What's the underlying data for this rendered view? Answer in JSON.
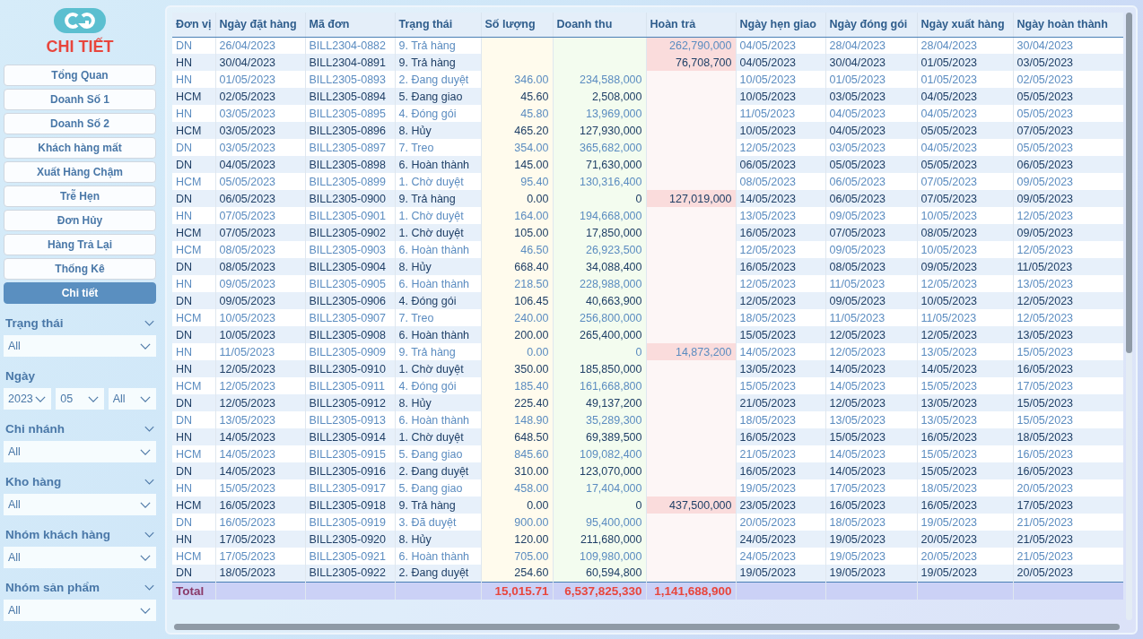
{
  "sidebar": {
    "title": "CHI TIẾT",
    "nav": [
      {
        "label": "Tổng Quan",
        "selected": false
      },
      {
        "label": "Doanh Số 1",
        "selected": false
      },
      {
        "label": "Doanh Số 2",
        "selected": false
      },
      {
        "label": "Khách hàng mất",
        "selected": false
      },
      {
        "label": "Xuất Hàng Chậm",
        "selected": false
      },
      {
        "label": "Trễ Hẹn",
        "selected": false
      },
      {
        "label": "Đơn Hủy",
        "selected": false
      },
      {
        "label": "Hàng Trả Lại",
        "selected": false
      },
      {
        "label": "Thống Kê",
        "selected": false
      },
      {
        "label": "Chi tiết",
        "selected": true
      }
    ],
    "filters": [
      {
        "kind": "slicer",
        "label": "Trạng thái",
        "dropdowns": [
          "All"
        ]
      },
      {
        "kind": "date",
        "label": "Ngày",
        "dropdowns": [
          "2023",
          "05",
          "All"
        ]
      },
      {
        "kind": "slicer",
        "label": "Chi nhánh",
        "dropdowns": [
          "All"
        ]
      },
      {
        "kind": "slicer",
        "label": "Kho hàng",
        "dropdowns": [
          "All"
        ]
      },
      {
        "kind": "slicer",
        "label": "Nhóm khách hàng",
        "dropdowns": [
          "All"
        ]
      },
      {
        "kind": "slicer",
        "label": "Nhóm sản phẩm",
        "dropdowns": [
          "All"
        ]
      }
    ]
  },
  "table": {
    "columns": [
      {
        "label": "Đơn vị",
        "kind": "text"
      },
      {
        "label": "Ngày đặt hàng",
        "kind": "text"
      },
      {
        "label": "Mã đơn",
        "kind": "text"
      },
      {
        "label": "Trạng thái",
        "kind": "text"
      },
      {
        "label": "Số lượng",
        "kind": "quantity"
      },
      {
        "label": "Doanh thu",
        "kind": "revenue"
      },
      {
        "label": "Hoàn trả",
        "kind": "refund"
      },
      {
        "label": "Ngày hẹn giao",
        "kind": "text"
      },
      {
        "label": "Ngày đóng gói",
        "kind": "text"
      },
      {
        "label": "Ngày xuất hàng",
        "kind": "text"
      },
      {
        "label": "Ngày hoàn thành",
        "kind": "text"
      }
    ],
    "rows": [
      {
        "unit": "DN",
        "ordered": "26/04/2023",
        "id": "BILL2304-0882",
        "status": "9. Trả hàng",
        "refund": "262,790,000",
        "due": "04/05/2023",
        "packed": "28/04/2023",
        "shipped": "28/04/2023",
        "completed": "30/04/2023"
      },
      {
        "unit": "HN",
        "ordered": "30/04/2023",
        "id": "BILL2304-0891",
        "status": "9. Trả hàng",
        "refund": "76,708,700",
        "due": "04/05/2023",
        "packed": "30/04/2023",
        "shipped": "01/05/2023",
        "completed": "03/05/2023"
      },
      {
        "unit": "HN",
        "ordered": "01/05/2023",
        "id": "BILL2305-0893",
        "status": "2. Đang duyệt",
        "qty": "346.00",
        "revenue": "234,588,000",
        "due": "10/05/2023",
        "packed": "01/05/2023",
        "shipped": "01/05/2023",
        "completed": "02/05/2023"
      },
      {
        "unit": "HCM",
        "ordered": "02/05/2023",
        "id": "BILL2305-0894",
        "status": "5. Đang giao",
        "qty": "45.60",
        "revenue": "2,508,000",
        "due": "10/05/2023",
        "packed": "03/05/2023",
        "shipped": "04/05/2023",
        "completed": "05/05/2023"
      },
      {
        "unit": "HN",
        "ordered": "03/05/2023",
        "id": "BILL2305-0895",
        "status": "4. Đóng gói",
        "qty": "45.80",
        "revenue": "13,969,000",
        "due": "11/05/2023",
        "packed": "04/05/2023",
        "shipped": "04/05/2023",
        "completed": "05/05/2023"
      },
      {
        "unit": "HCM",
        "ordered": "03/05/2023",
        "id": "BILL2305-0896",
        "status": "8. Hủy",
        "qty": "465.20",
        "revenue": "127,930,000",
        "due": "10/05/2023",
        "packed": "04/05/2023",
        "shipped": "05/05/2023",
        "completed": "07/05/2023"
      },
      {
        "unit": "DN",
        "ordered": "03/05/2023",
        "id": "BILL2305-0897",
        "status": "7. Treo",
        "qty": "354.00",
        "revenue": "365,682,000",
        "due": "12/05/2023",
        "packed": "03/05/2023",
        "shipped": "04/05/2023",
        "completed": "05/05/2023"
      },
      {
        "unit": "DN",
        "ordered": "04/05/2023",
        "id": "BILL2305-0898",
        "status": "6. Hoàn thành",
        "qty": "145.00",
        "revenue": "71,630,000",
        "due": "06/05/2023",
        "packed": "05/05/2023",
        "shipped": "05/05/2023",
        "completed": "06/05/2023"
      },
      {
        "unit": "HCM",
        "ordered": "05/05/2023",
        "id": "BILL2305-0899",
        "status": "1. Chờ duyệt",
        "qty": "95.40",
        "revenue": "130,316,400",
        "due": "08/05/2023",
        "packed": "06/05/2023",
        "shipped": "07/05/2023",
        "completed": "09/05/2023"
      },
      {
        "unit": "DN",
        "ordered": "06/05/2023",
        "id": "BILL2305-0900",
        "status": "9. Trả hàng",
        "qty": "0.00",
        "revenue": "0",
        "refund": "127,019,000",
        "due": "14/05/2023",
        "packed": "06/05/2023",
        "shipped": "07/05/2023",
        "completed": "09/05/2023"
      },
      {
        "unit": "HN",
        "ordered": "07/05/2023",
        "id": "BILL2305-0901",
        "status": "1. Chờ duyệt",
        "qty": "164.00",
        "revenue": "194,668,000",
        "due": "13/05/2023",
        "packed": "09/05/2023",
        "shipped": "10/05/2023",
        "completed": "12/05/2023"
      },
      {
        "unit": "HCM",
        "ordered": "07/05/2023",
        "id": "BILL2305-0902",
        "status": "1. Chờ duyệt",
        "qty": "105.00",
        "revenue": "17,850,000",
        "due": "16/05/2023",
        "packed": "07/05/2023",
        "shipped": "08/05/2023",
        "completed": "09/05/2023"
      },
      {
        "unit": "HCM",
        "ordered": "08/05/2023",
        "id": "BILL2305-0903",
        "status": "6. Hoàn thành",
        "qty": "46.50",
        "revenue": "26,923,500",
        "due": "12/05/2023",
        "packed": "09/05/2023",
        "shipped": "10/05/2023",
        "completed": "12/05/2023"
      },
      {
        "unit": "DN",
        "ordered": "08/05/2023",
        "id": "BILL2305-0904",
        "status": "8. Hủy",
        "qty": "668.40",
        "revenue": "34,088,400",
        "due": "16/05/2023",
        "packed": "08/05/2023",
        "shipped": "09/05/2023",
        "completed": "11/05/2023"
      },
      {
        "unit": "HN",
        "ordered": "09/05/2023",
        "id": "BILL2305-0905",
        "status": "6. Hoàn thành",
        "qty": "218.50",
        "revenue": "228,988,000",
        "due": "12/05/2023",
        "packed": "11/05/2023",
        "shipped": "12/05/2023",
        "completed": "13/05/2023"
      },
      {
        "unit": "DN",
        "ordered": "09/05/2023",
        "id": "BILL2305-0906",
        "status": "4. Đóng gói",
        "qty": "106.45",
        "revenue": "40,663,900",
        "due": "12/05/2023",
        "packed": "09/05/2023",
        "shipped": "10/05/2023",
        "completed": "12/05/2023"
      },
      {
        "unit": "HCM",
        "ordered": "10/05/2023",
        "id": "BILL2305-0907",
        "status": "7. Treo",
        "qty": "240.00",
        "revenue": "256,800,000",
        "due": "18/05/2023",
        "packed": "11/05/2023",
        "shipped": "11/05/2023",
        "completed": "12/05/2023"
      },
      {
        "unit": "DN",
        "ordered": "10/05/2023",
        "id": "BILL2305-0908",
        "status": "6. Hoàn thành",
        "qty": "200.00",
        "revenue": "265,400,000",
        "due": "15/05/2023",
        "packed": "12/05/2023",
        "shipped": "12/05/2023",
        "completed": "13/05/2023"
      },
      {
        "unit": "HN",
        "ordered": "11/05/2023",
        "id": "BILL2305-0909",
        "status": "9. Trả hàng",
        "qty": "0.00",
        "revenue": "0",
        "refund": "14,873,200",
        "due": "14/05/2023",
        "packed": "12/05/2023",
        "shipped": "13/05/2023",
        "completed": "15/05/2023"
      },
      {
        "unit": "HN",
        "ordered": "12/05/2023",
        "id": "BILL2305-0910",
        "status": "1. Chờ duyệt",
        "qty": "350.00",
        "revenue": "185,850,000",
        "due": "13/05/2023",
        "packed": "14/05/2023",
        "shipped": "14/05/2023",
        "completed": "16/05/2023"
      },
      {
        "unit": "HCM",
        "ordered": "12/05/2023",
        "id": "BILL2305-0911",
        "status": "4. Đóng gói",
        "qty": "185.40",
        "revenue": "161,668,800",
        "due": "15/05/2023",
        "packed": "14/05/2023",
        "shipped": "15/05/2023",
        "completed": "17/05/2023"
      },
      {
        "unit": "DN",
        "ordered": "12/05/2023",
        "id": "BILL2305-0912",
        "status": "8. Hủy",
        "qty": "225.40",
        "revenue": "49,137,200",
        "due": "21/05/2023",
        "packed": "12/05/2023",
        "shipped": "13/05/2023",
        "completed": "15/05/2023"
      },
      {
        "unit": "DN",
        "ordered": "13/05/2023",
        "id": "BILL2305-0913",
        "status": "6. Hoàn thành",
        "qty": "148.90",
        "revenue": "35,289,300",
        "due": "18/05/2023",
        "packed": "13/05/2023",
        "shipped": "13/05/2023",
        "completed": "15/05/2023"
      },
      {
        "unit": "HN",
        "ordered": "14/05/2023",
        "id": "BILL2305-0914",
        "status": "1. Chờ duyệt",
        "qty": "648.50",
        "revenue": "69,389,500",
        "due": "16/05/2023",
        "packed": "15/05/2023",
        "shipped": "16/05/2023",
        "completed": "18/05/2023"
      },
      {
        "unit": "HCM",
        "ordered": "14/05/2023",
        "id": "BILL2305-0915",
        "status": "5. Đang giao",
        "qty": "845.60",
        "revenue": "109,082,400",
        "due": "21/05/2023",
        "packed": "14/05/2023",
        "shipped": "15/05/2023",
        "completed": "16/05/2023"
      },
      {
        "unit": "DN",
        "ordered": "14/05/2023",
        "id": "BILL2305-0916",
        "status": "2. Đang duyệt",
        "qty": "310.00",
        "revenue": "123,070,000",
        "due": "16/05/2023",
        "packed": "14/05/2023",
        "shipped": "15/05/2023",
        "completed": "16/05/2023"
      },
      {
        "unit": "HN",
        "ordered": "15/05/2023",
        "id": "BILL2305-0917",
        "status": "5. Đang giao",
        "qty": "458.00",
        "revenue": "17,404,000",
        "due": "19/05/2023",
        "packed": "17/05/2023",
        "shipped": "18/05/2023",
        "completed": "20/05/2023"
      },
      {
        "unit": "HCM",
        "ordered": "16/05/2023",
        "id": "BILL2305-0918",
        "status": "9. Trả hàng",
        "qty": "0.00",
        "revenue": "0",
        "refund": "437,500,000",
        "due": "23/05/2023",
        "packed": "16/05/2023",
        "shipped": "16/05/2023",
        "completed": "17/05/2023"
      },
      {
        "unit": "DN",
        "ordered": "16/05/2023",
        "id": "BILL2305-0919",
        "status": "3. Đã duyệt",
        "qty": "900.00",
        "revenue": "95,400,000",
        "due": "20/05/2023",
        "packed": "18/05/2023",
        "shipped": "19/05/2023",
        "completed": "21/05/2023"
      },
      {
        "unit": "HN",
        "ordered": "17/05/2023",
        "id": "BILL2305-0920",
        "status": "8. Hủy",
        "qty": "120.00",
        "revenue": "211,680,000",
        "due": "24/05/2023",
        "packed": "19/05/2023",
        "shipped": "20/05/2023",
        "completed": "21/05/2023"
      },
      {
        "unit": "HCM",
        "ordered": "17/05/2023",
        "id": "BILL2305-0921",
        "status": "6. Hoàn thành",
        "qty": "705.00",
        "revenue": "109,980,000",
        "due": "24/05/2023",
        "packed": "19/05/2023",
        "shipped": "20/05/2023",
        "completed": "21/05/2023"
      },
      {
        "unit": "DN",
        "ordered": "18/05/2023",
        "id": "BILL2305-0922",
        "status": "2. Đang duyệt",
        "qty": "254.60",
        "revenue": "60,594,800",
        "due": "19/05/2023",
        "packed": "19/05/2023",
        "shipped": "19/05/2023",
        "completed": "20/05/2023"
      }
    ],
    "total": {
      "unit": "Total",
      "qty": "15,015.71",
      "revenue": "6,537,825,330",
      "refund": "1,141,688,900"
    }
  }
}
